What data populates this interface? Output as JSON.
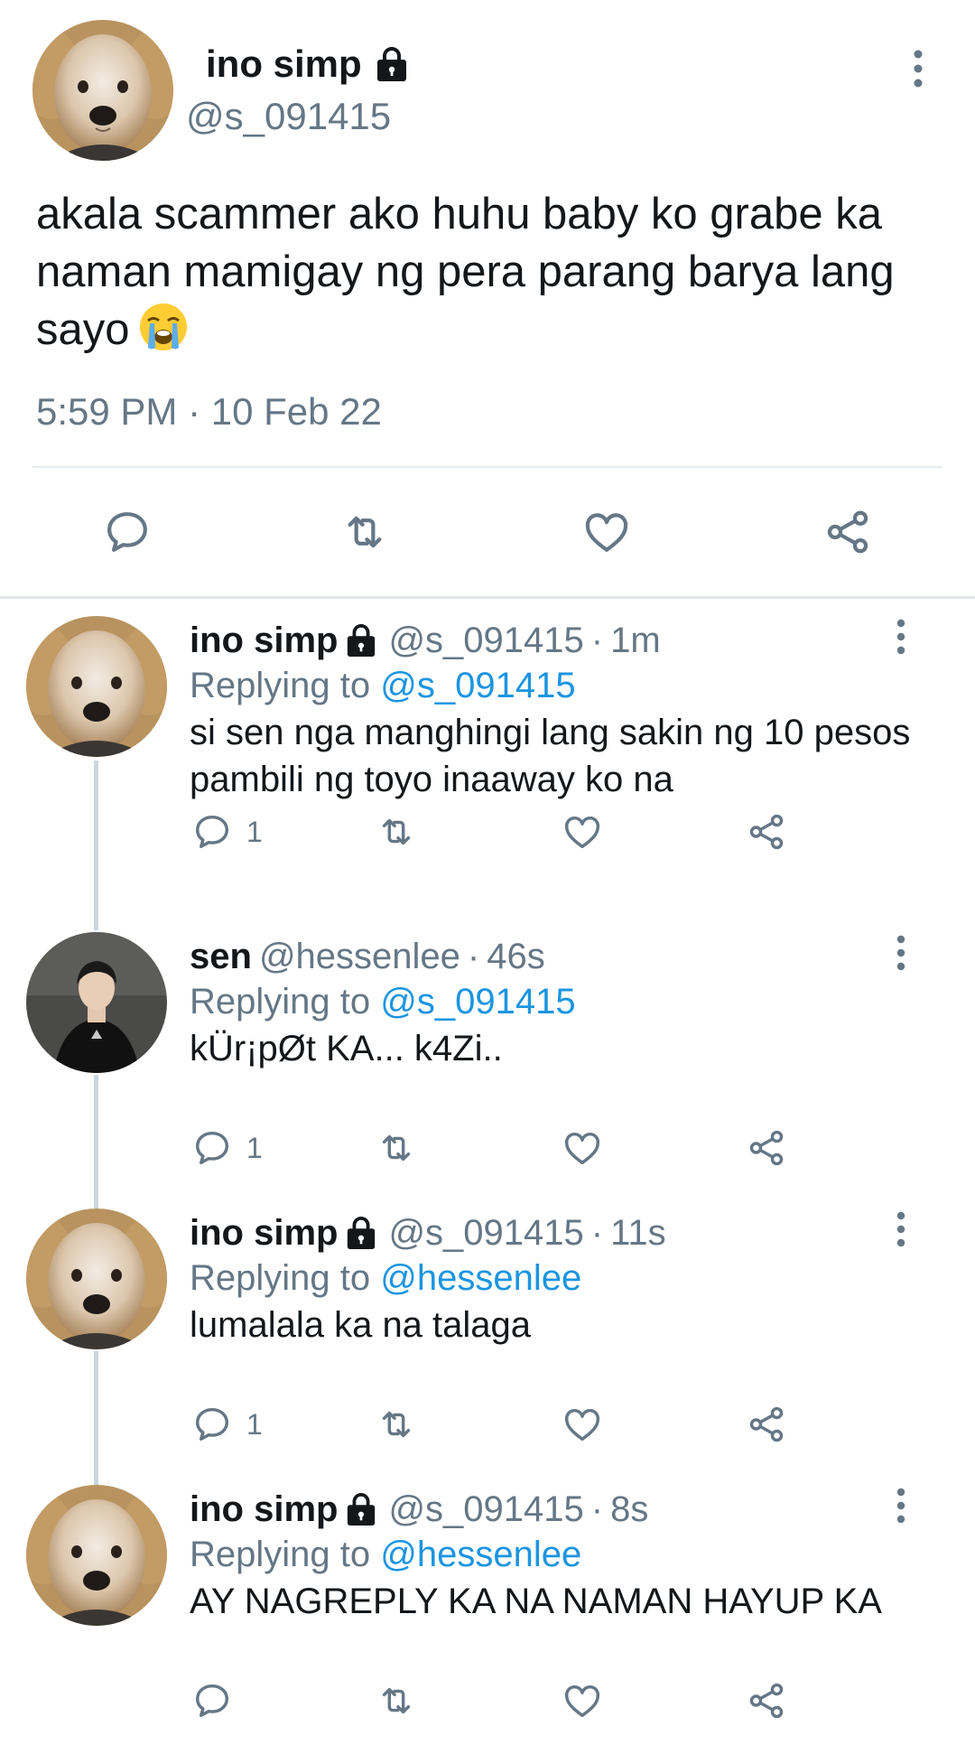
{
  "main_tweet": {
    "name": "ino simp",
    "handle": "@s_091415",
    "text": "akala scammer ako huhu baby ko grabe ka naman mamigay ng pera parang barya lang sayo",
    "timestamp": "5:59 PM · 10 Feb 22",
    "emoji": "loudly-crying-face"
  },
  "replies": [
    {
      "name": "ino simp",
      "handle": "@s_091415",
      "separator": "·",
      "time": "1m",
      "replying_prefix": "Replying to",
      "replying_to": "@s_091415",
      "text": "si sen nga manghingi lang sakin ng 10 pesos pambili ng toyo inaaway ko na",
      "reply_count": "1",
      "avatar": "dog-avatar"
    },
    {
      "name": "sen",
      "handle": "@hessenlee",
      "separator": "·",
      "time": "46s",
      "replying_prefix": "Replying to",
      "replying_to": "@s_091415",
      "text": "kÜr¡pØt KA... k4Zi..",
      "reply_count": "1",
      "avatar": "person-avatar"
    },
    {
      "name": "ino simp",
      "handle": "@s_091415",
      "separator": "·",
      "time": "11s",
      "replying_prefix": "Replying to",
      "replying_to": "@hessenlee",
      "text": "lumalala ka na talaga",
      "reply_count": "1",
      "avatar": "dog-avatar"
    },
    {
      "name": "ino simp",
      "handle": "@s_091415",
      "separator": "·",
      "time": "8s",
      "replying_prefix": "Replying to",
      "replying_to": "@hessenlee",
      "text": "AY NAGREPLY KA NA NAMAN HAYUP KA",
      "reply_count": "",
      "avatar": "dog-avatar"
    }
  ],
  "colors": {
    "text_primary": "#14171a",
    "text_secondary": "#657786",
    "mention": "#1b95e0",
    "icon": "#657786",
    "divider": "#e6ecf0"
  }
}
